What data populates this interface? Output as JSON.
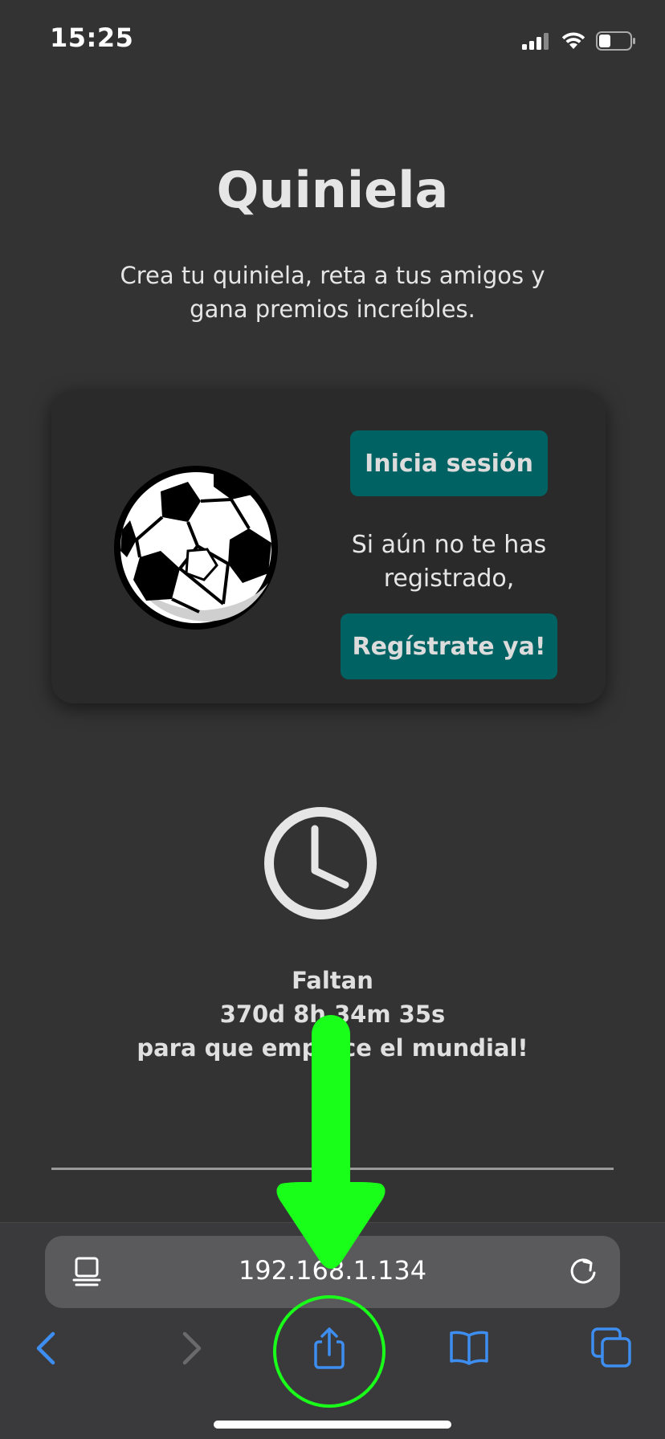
{
  "status_bar": {
    "time": "15:25"
  },
  "page": {
    "title": "Quiniela",
    "subtitle": "Crea tu quiniela, reta a tus amigos y gana premios increíbles."
  },
  "card": {
    "login_label": "Inicia sesión",
    "register_prompt": "Si aún no te has registrado,",
    "register_label": "Regístrate ya!"
  },
  "countdown": {
    "line1": "Faltan",
    "line2": "370d 8h 34m 35s",
    "line3": "para que empiece el mundial!"
  },
  "browser": {
    "url": "192.168.1.134"
  },
  "colors": {
    "background": "#333333",
    "card": "#2a2a2a",
    "button": "#006262",
    "annotation": "#1aff1a",
    "link_blue": "#3d8ef0"
  }
}
